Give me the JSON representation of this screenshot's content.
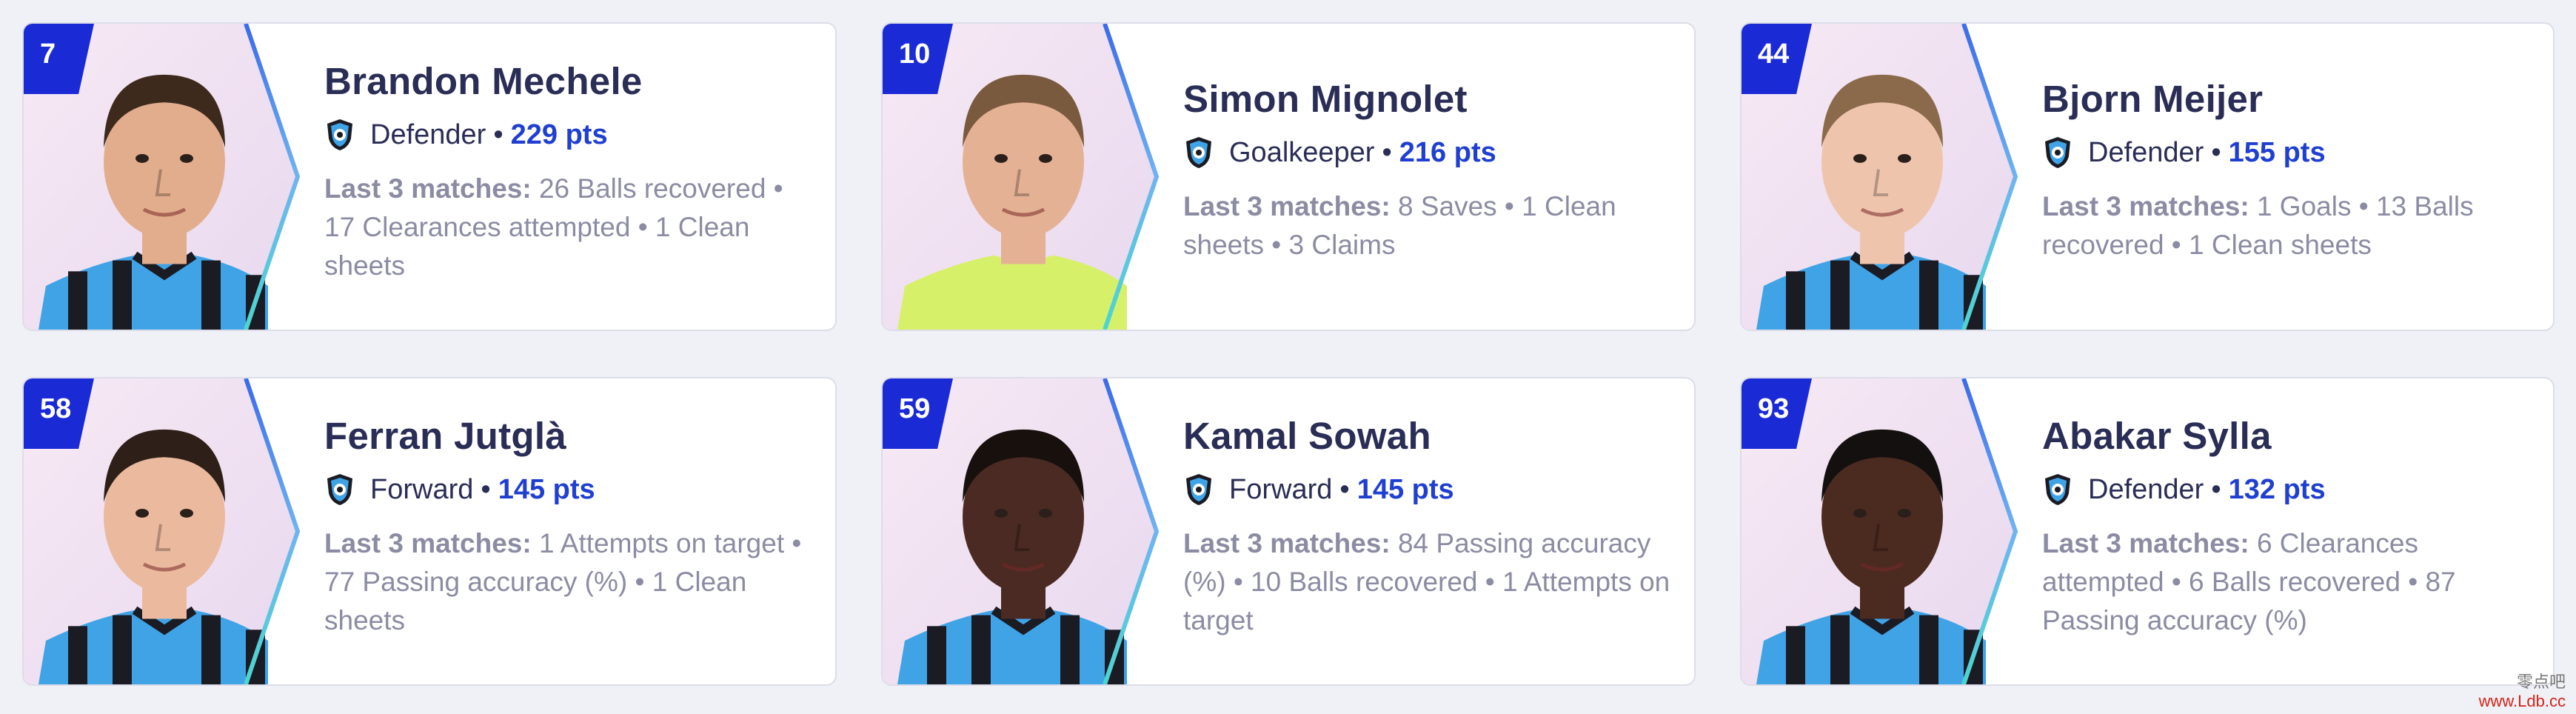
{
  "colors": {
    "background": "#f0f1f6",
    "card": "#ffffff",
    "number_badge": "#1a2bd6",
    "name": "#2a2d55",
    "points": "#1f3fd1",
    "stats": "#8b8ca3",
    "kit_blue": "#3fa3e6",
    "kit_black": "#1b1b24",
    "keeper_kit": "#d7f06a"
  },
  "stats_label": "Last 3 matches:",
  "players": [
    {
      "number": "7",
      "name": "Brandon Mechele",
      "position": "Defender",
      "points": "229 pts",
      "stats": "26 Balls recovered • 17 Clearances attempted • 1 Clean sheets",
      "kit": "club",
      "skin": "#e2ad8c",
      "hair": "#3d2a1d"
    },
    {
      "number": "10",
      "name": "Simon Mignolet",
      "position": "Goalkeeper",
      "points": "216 pts",
      "stats": "8 Saves • 1 Clean sheets • 3 Claims",
      "kit": "keeper",
      "skin": "#e4b194",
      "hair": "#7a5a3e"
    },
    {
      "number": "44",
      "name": "Bjorn Meijer",
      "position": "Defender",
      "points": "155 pts",
      "stats": "1 Goals • 13 Balls recovered • 1 Clean sheets",
      "kit": "club",
      "skin": "#efc4ad",
      "hair": "#8a6a4a"
    },
    {
      "number": "58",
      "name": "Ferran Jutglà",
      "position": "Forward",
      "points": "145 pts",
      "stats": "1 Attempts on target • 77 Passing accuracy (%) • 1 Clean sheets",
      "kit": "club",
      "skin": "#ebb99e",
      "hair": "#2e2018"
    },
    {
      "number": "59",
      "name": "Kamal Sowah",
      "position": "Forward",
      "points": "145 pts",
      "stats": "84 Passing accuracy (%) • 10 Balls recovered • 1 Attempts on target",
      "kit": "club",
      "skin": "#4a2a22",
      "hair": "#17100d"
    },
    {
      "number": "93",
      "name": "Abakar Sylla",
      "position": "Defender",
      "points": "132 pts",
      "stats": "6 Clearances attempted • 6 Balls recovered • 87 Passing accuracy (%)",
      "kit": "club",
      "skin": "#4b2a20",
      "hair": "#141010"
    }
  ],
  "watermark": {
    "line1": "零点吧",
    "line2": "www.Ldb.cc"
  }
}
